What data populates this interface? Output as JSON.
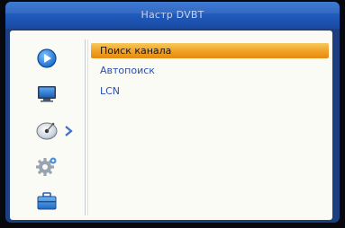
{
  "window": {
    "title": "Настр DVBT"
  },
  "sidebar": {
    "items": [
      {
        "icon": "play-icon"
      },
      {
        "icon": "monitor-icon"
      },
      {
        "icon": "satellite-dish-icon",
        "active": true
      },
      {
        "icon": "gear-icon"
      },
      {
        "icon": "briefcase-icon"
      }
    ]
  },
  "menu": {
    "items": [
      {
        "label": "Поиск канала",
        "selected": true
      },
      {
        "label": "Автопоиск",
        "selected": false
      },
      {
        "label": "LCN",
        "selected": false
      }
    ]
  },
  "colors": {
    "frame": "#1d3e80",
    "title_bar": "#1f58b8",
    "panel": "#fbfbf5",
    "selection": "#f0a024",
    "menu_text": "#2a4fb0"
  }
}
